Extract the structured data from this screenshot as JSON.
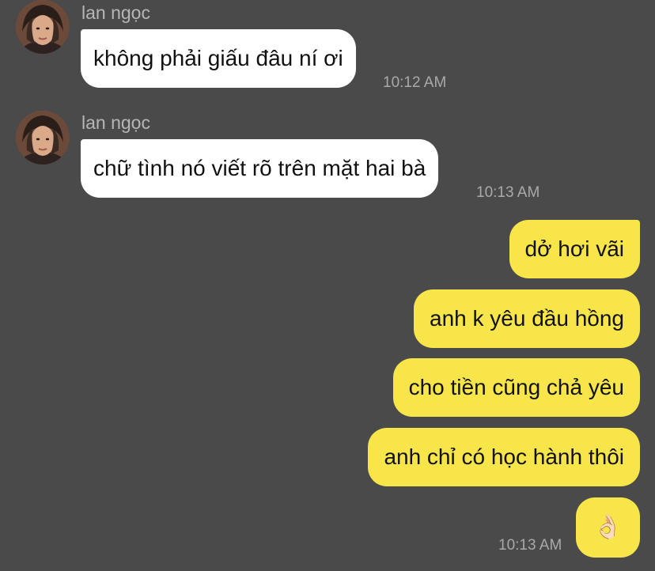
{
  "conversation": {
    "incoming": [
      {
        "sender": "lan ngọc",
        "text": "không phải giấu đâu ní ơi",
        "time": "10:12 AM"
      },
      {
        "sender": "lan ngọc",
        "text": "chữ tình nó viết rõ trên mặt hai bà",
        "time": "10:13 AM"
      }
    ],
    "outgoing": [
      {
        "text": "dở hơi vãi"
      },
      {
        "text": "anh k yêu đầu hồng"
      },
      {
        "text": "cho tiền cũng chả yêu"
      },
      {
        "text": "anh chỉ có học hành thôi"
      },
      {
        "text": "👌🏻"
      }
    ],
    "outgoing_time": "10:13 AM"
  },
  "icons": {
    "avatar": "profile-photo-woman",
    "sticker": "ok-hand-emoji"
  },
  "colors": {
    "background": "#4a4a4a",
    "incoming_bubble": "#ffffff",
    "outgoing_bubble": "#f7e54a",
    "sender_name": "#b6b6b6",
    "timestamp": "#a9a9a9"
  }
}
